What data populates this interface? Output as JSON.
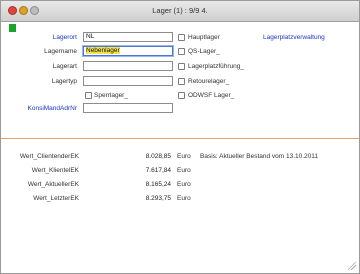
{
  "window": {
    "title": "Lager (1) : 9/9 4."
  },
  "form": {
    "lagerort": {
      "label": "Lagerort",
      "value": "NL"
    },
    "lagername": {
      "label": "Lagername",
      "value": "Nebenlager"
    },
    "lagerart": {
      "label": "Lagerart",
      "value": ""
    },
    "lagertyp": {
      "label": "Lagertyp",
      "value": ""
    },
    "sperrlager": {
      "label": "Sperrlager_"
    },
    "konsi": {
      "label": "KonsiMandAdrNr",
      "value": ""
    }
  },
  "checkboxes": [
    {
      "label": "Hauptlager"
    },
    {
      "label": "QS-Lager_"
    },
    {
      "label": "Lagerplatzführung_"
    },
    {
      "label": "Retourelager_"
    },
    {
      "label": "ODWSF Lager_"
    }
  ],
  "lagerplatz_link": "Lagerplatzverwaltung",
  "werte": [
    {
      "name": "Wert_ClientenderEK",
      "value": "8.028,85",
      "currency": "Euro"
    },
    {
      "name": "Wert_KlientelEK",
      "value": "7.617,84",
      "currency": "Euro"
    },
    {
      "name": "Wert_AktuellerEK",
      "value": "8.165,24",
      "currency": "Euro"
    },
    {
      "name": "Wert_LetzterEK",
      "value": "8.293,75",
      "currency": "Euro"
    }
  ],
  "basis_text": "Basis: Aktueller Bestand vom 13.10.2011"
}
